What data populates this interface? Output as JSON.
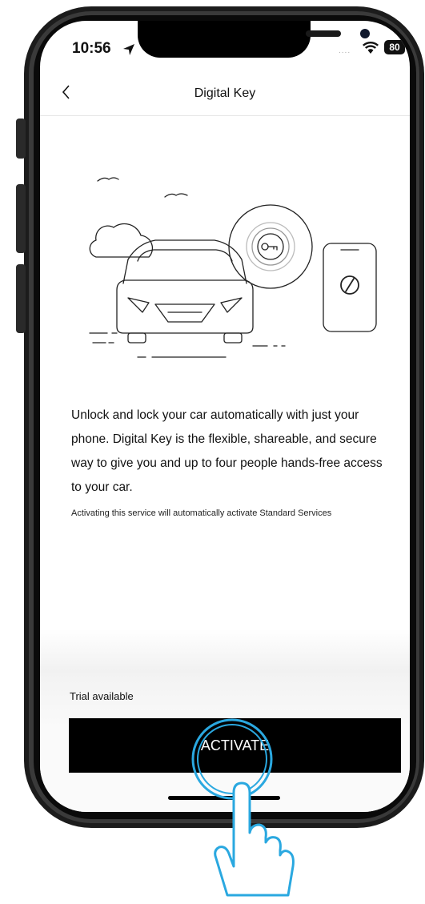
{
  "status_bar": {
    "time": "10:56",
    "location_icon": "location-arrow-icon",
    "signal": "....",
    "wifi_icon": "wifi-icon",
    "battery": "80"
  },
  "nav": {
    "back_icon": "chevron-left-icon",
    "title": "Digital Key"
  },
  "content": {
    "illustration": "car-with-digital-key-illustration",
    "description": "Unlock and lock your car automatically with just your phone. Digital Key is the flexible, shareable, and secure way to give you and up to four people hands-free access to your car.",
    "disclaimer": "Activating this service will automatically activate Standard Services"
  },
  "footer": {
    "trial_label": "Trial available",
    "activate_label": "ACTIVATE"
  },
  "colors": {
    "button_bg": "#000000",
    "tap_highlight": "#2aa8e0"
  }
}
